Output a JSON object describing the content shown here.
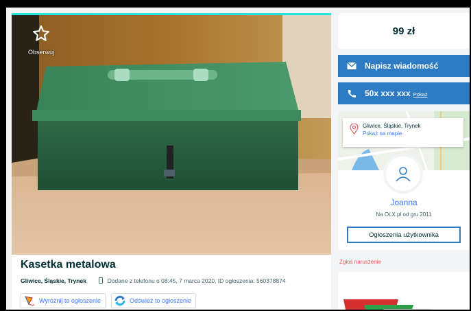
{
  "listing": {
    "observe_label": "Obserwuj",
    "title": "Kasetka metalowa",
    "location": "Gliwice, Śląskie, Trynek",
    "added_info": "Dodane z telefonu  o 08:45, 7 marca 2020, ID ogłoszenia: 560378874",
    "promote_label": "Wyróżnij to ogłoszenie",
    "refresh_label": "Odśwież to ogłoszenie"
  },
  "sidebar": {
    "price": "99 zł",
    "message_button": "Napisz wiadomość",
    "phone_number": "50x xxx xxx",
    "phone_show": "Pokaż",
    "map_location": "Gliwice, Śląskie, Trynek",
    "map_link": "Pokaż na mapie",
    "user_name": "Joanna",
    "user_since": "Na OLX.pl od gru 2011",
    "user_ads_button": "Ogłoszenia użytkownika",
    "report_link": "Zgłoś naruszenie"
  },
  "colors": {
    "accent_teal": "#23e5db",
    "button_blue": "#2d7bc2",
    "link_blue": "#3a77ff",
    "report_red": "#e05c5c"
  },
  "icons": {
    "observe": "star-outline-icon",
    "phone_small": "phone-icon",
    "promote": "kite-icon",
    "refresh": "refresh-icon",
    "message": "envelope-icon",
    "call": "phone-handset-icon",
    "map_pin": "map-pin-icon",
    "avatar": "user-icon"
  }
}
